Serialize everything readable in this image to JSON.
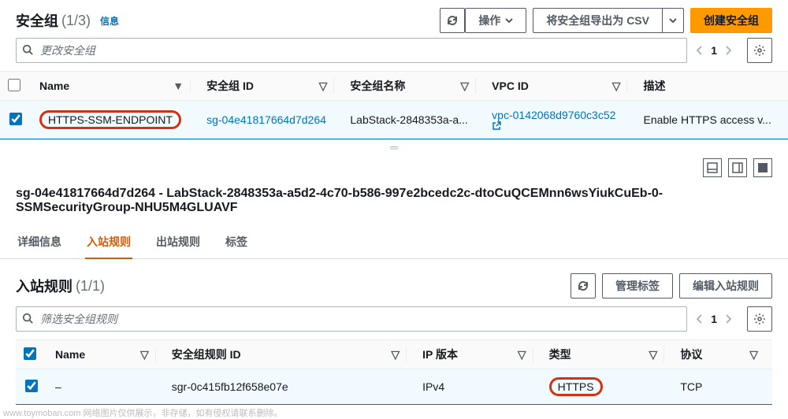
{
  "top": {
    "title": "安全组",
    "count": "(1/3)",
    "info": "信息",
    "actions_label": "操作",
    "export_label": "将安全组导出为 CSV",
    "create_label": "创建安全组",
    "search_placeholder": "更改安全组",
    "page": "1"
  },
  "sg_table": {
    "headers": {
      "name": "Name",
      "sgid": "安全组 ID",
      "sgname": "安全组名称",
      "vpc": "VPC ID",
      "desc": "描述"
    },
    "row": {
      "name": "HTTPS-SSM-ENDPOINT",
      "sgid": "sg-04e41817664d7d264",
      "sgname": "LabStack-2848353a-a...",
      "vpc": "vpc-0142068d9760c3c52",
      "desc": "Enable HTTPS access v..."
    }
  },
  "detail": {
    "title": "sg-04e41817664d7d264 - LabStack-2848353a-a5d2-4c70-b586-997e2bcedc2c-dtoCuQCEMnn6wsYiukCuEb-0-SSMSecurityGroup-NHU5M4GLUAVF",
    "tabs": {
      "info": "详细信息",
      "inbound": "入站规则",
      "outbound": "出站规则",
      "tags": "标签"
    }
  },
  "rules": {
    "title": "入站规则",
    "count": "(1/1)",
    "manage_tags": "管理标签",
    "edit_rules": "编辑入站规则",
    "search_placeholder": "筛选安全组规则",
    "page": "1",
    "headers": {
      "name": "Name",
      "ruleid": "安全组规则 ID",
      "ipver": "IP 版本",
      "type": "类型",
      "proto": "协议"
    },
    "row": {
      "name": "–",
      "ruleid": "sgr-0c415fb12f658e07e",
      "ipver": "IPv4",
      "type": "HTTPS",
      "proto": "TCP"
    }
  },
  "watermark": "www.toymoban.com  网络图片仅供展示，非存储，如有侵权请联系删除。"
}
